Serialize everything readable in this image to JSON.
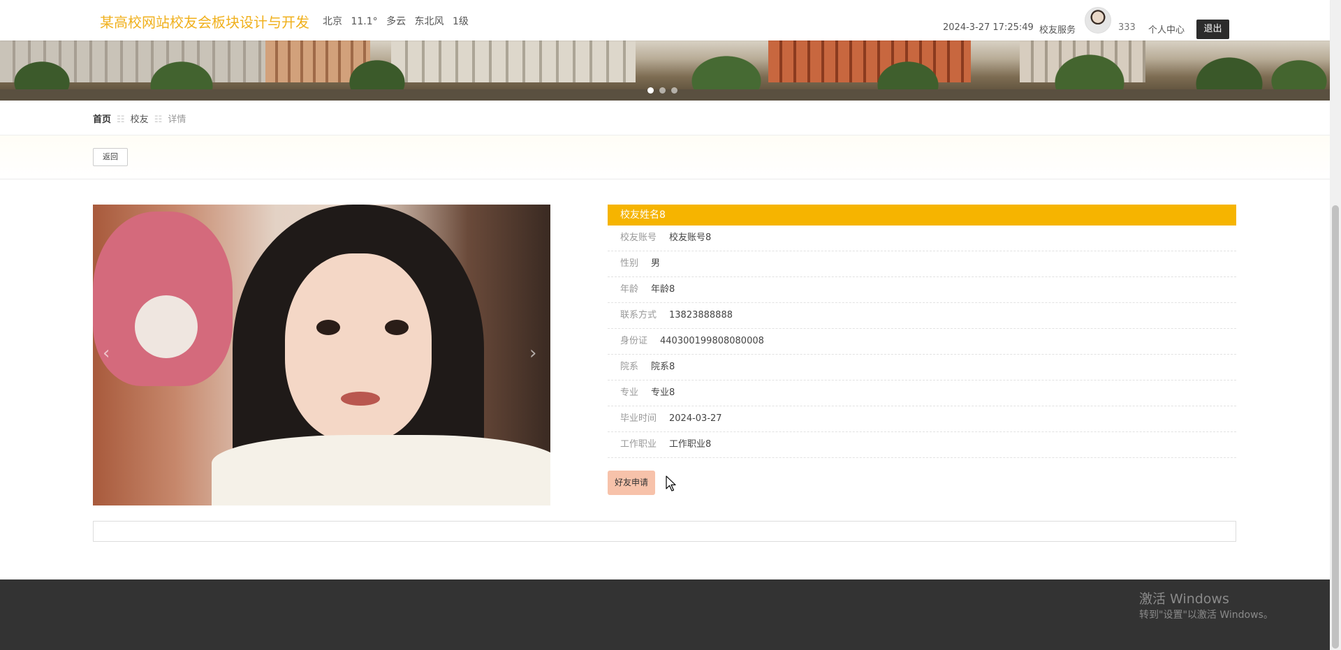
{
  "header": {
    "site_title": "某高校网站校友会板块设计与开发",
    "weather": {
      "city": "北京",
      "temp": "11.1°",
      "condition": "多云",
      "wind": "东北风",
      "level": "1级"
    },
    "clock": "2024-3-27 17:25:49",
    "service": "校友服务",
    "username": "333",
    "center": "个人中心",
    "logout": "退出"
  },
  "breadcrumb": {
    "home": "首页",
    "sep": "☷",
    "section": "校友",
    "current": "详情"
  },
  "toolbar": {
    "back": "返回"
  },
  "detail": {
    "title": "校友姓名8",
    "fields": [
      {
        "label": "校友账号",
        "value": "校友账号8"
      },
      {
        "label": "性别",
        "value": "男"
      },
      {
        "label": "年龄",
        "value": "年龄8"
      },
      {
        "label": "联系方式",
        "value": "13823888888"
      },
      {
        "label": "身份证",
        "value": "440300199808080008"
      },
      {
        "label": "院系",
        "value": "院系8"
      },
      {
        "label": "专业",
        "value": "专业8"
      },
      {
        "label": "毕业时间",
        "value": "2024-03-27"
      },
      {
        "label": "工作职业",
        "value": "工作职业8"
      }
    ],
    "friend_button": "好友申请"
  },
  "carousel": {
    "prev": "‹",
    "next": "›"
  },
  "watermark": {
    "line1": "激活 Windows",
    "line2": "转到\"设置\"以激活 Windows。"
  },
  "colors": {
    "accent": "#f6b400",
    "title": "#f0b01c",
    "friend_btn": "#f7c2aa",
    "footer": "#333333"
  }
}
